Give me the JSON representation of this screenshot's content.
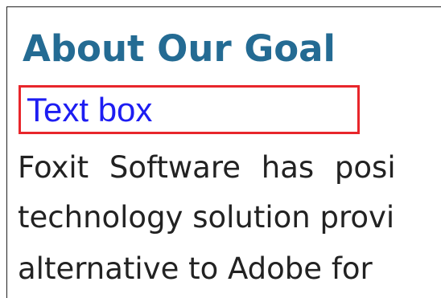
{
  "heading": "About Our Goal",
  "text_box": {
    "label": "Text box"
  },
  "paragraph": {
    "lines": [
      "Foxit Software has posi",
      "technology solution provi",
      "alternative to Adobe for"
    ]
  },
  "colors": {
    "heading": "#246b93",
    "text_box_border": "#e8262b",
    "text_box_text": "#1d1df2",
    "body_text": "#222222"
  }
}
